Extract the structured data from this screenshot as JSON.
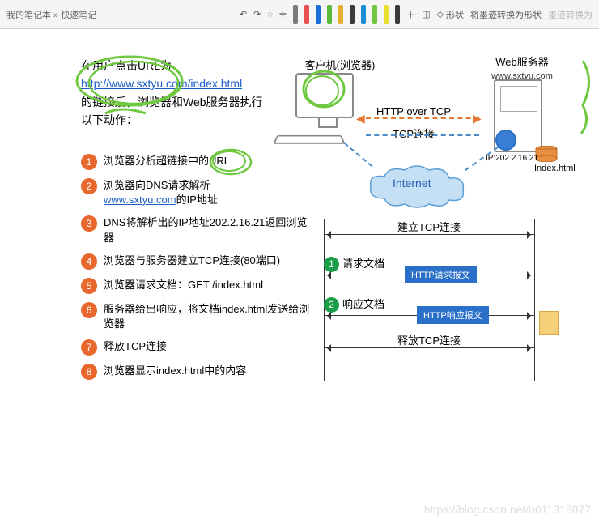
{
  "toolbar": {
    "breadcrumb_prefix": "我的笔记本",
    "breadcrumb_sep": " » ",
    "breadcrumb_current": "快速笔记",
    "shape_btn": "形状",
    "convert_btn": "将墨迹转换为形状",
    "ink_btn": "墨迹转换为",
    "pens": [
      "#7a7a7a",
      "#e84f4f",
      "#1a6fd8",
      "#5bb83b",
      "#e8b030",
      "#3a3a3a",
      "#1a8fd8",
      "#6fc840",
      "#e8e030",
      "#3a3a3a"
    ]
  },
  "intro": {
    "l1": "在用户点击URL为",
    "url": "http://www.sxtyu.com/index.html",
    "l2a": "的链接后，浏览器和",
    "l2b": "Web服务器执行",
    "l3": "以下动作："
  },
  "steps": [
    {
      "n": "1",
      "text": "浏览器分析超链接中的URL"
    },
    {
      "n": "2",
      "text_a": "浏览器向DNS请求解析",
      "link": "www.sxtyu.com",
      "text_b": "的IP地址"
    },
    {
      "n": "3",
      "text": "DNS将解析出的IP地址202.2.16.21返回浏览器"
    },
    {
      "n": "4",
      "text": "浏览器与服务器建立TCP连接(80端口)"
    },
    {
      "n": "5",
      "text": "浏览器请求文档：GET /index.html"
    },
    {
      "n": "6",
      "text": "服务器给出响应，将文档index.html发送给浏览器"
    },
    {
      "n": "7",
      "text": "释放TCP连接"
    },
    {
      "n": "8",
      "text": "浏览器显示index.html中的内容"
    }
  ],
  "diagram": {
    "client_label": "客户机(浏览器)",
    "server_label": "Web服务器",
    "server_domain": "www.sxtyu.com",
    "http_over_tcp": "HTTP over TCP",
    "tcp_conn": "TCP连接",
    "internet": "Internet",
    "ip": "IP:202.2.16.21",
    "index_file": "Index.html",
    "seq": {
      "establish": "建立TCP连接",
      "req_doc_n": "1",
      "req_doc": "请求文档",
      "req_msg": "HTTP请求报文",
      "resp_doc_n": "2",
      "resp_doc": "响应文档",
      "resp_msg": "HTTP响应报文",
      "release": "释放TCP连接"
    }
  },
  "watermark": "https://blog.csdn.net/u011318077"
}
